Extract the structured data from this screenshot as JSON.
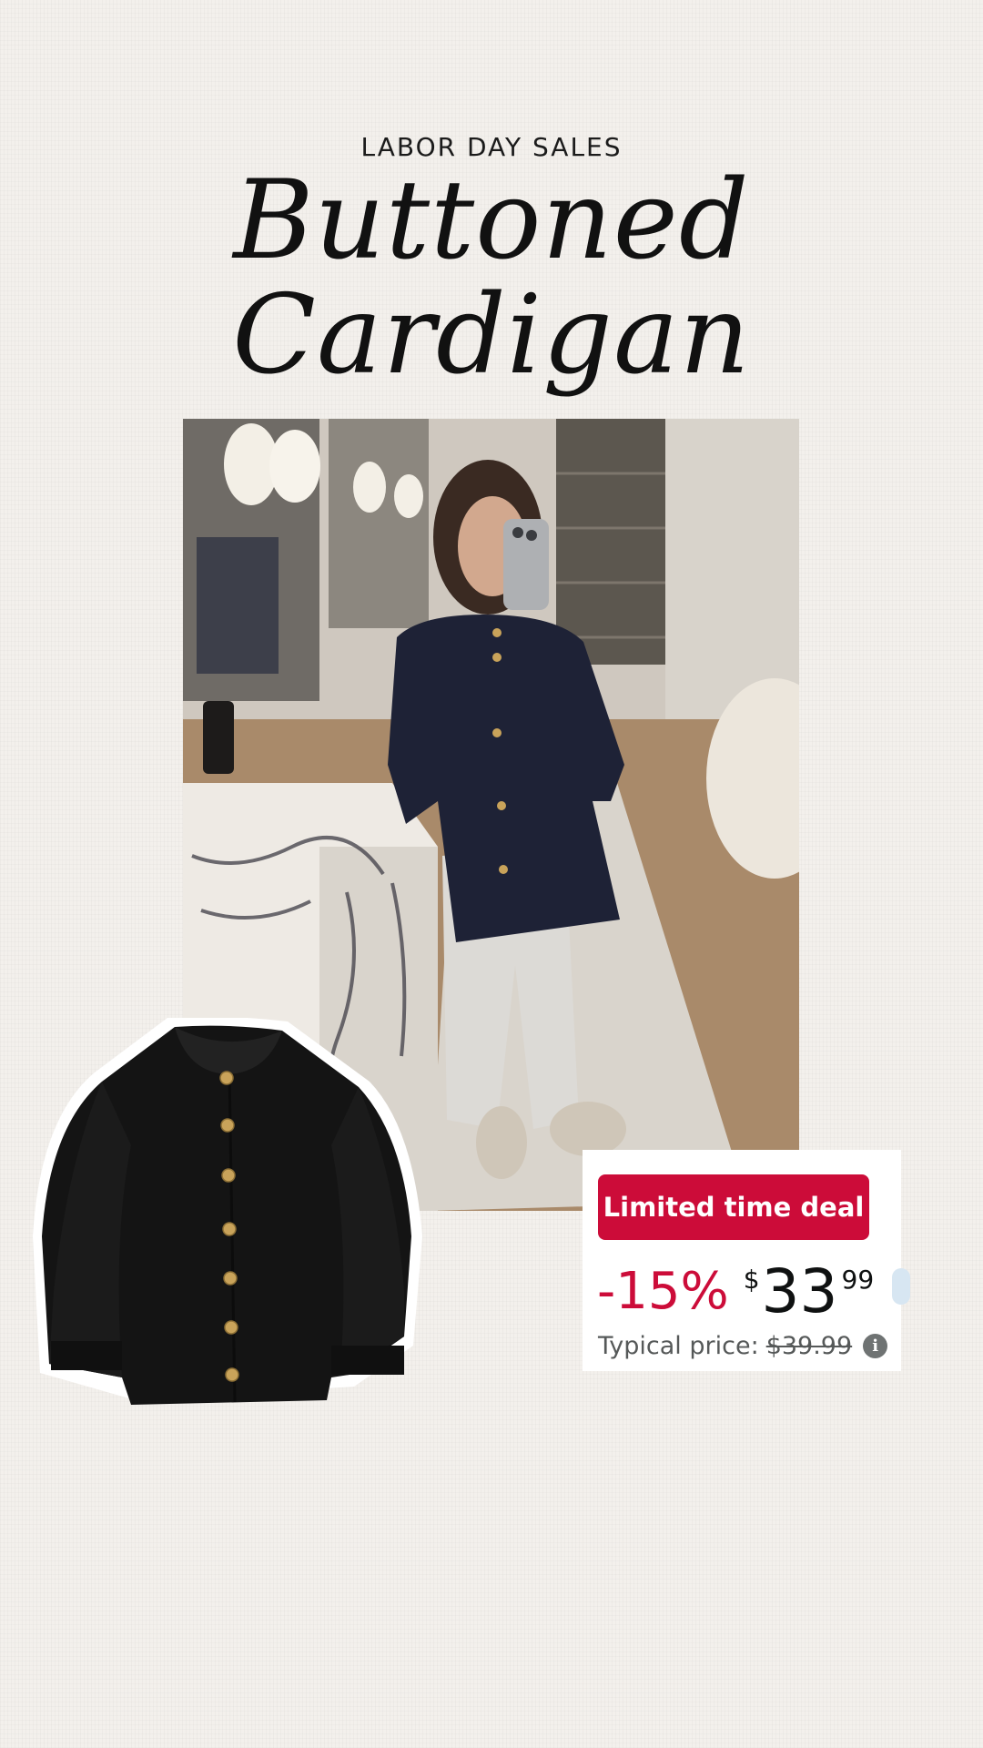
{
  "header": {
    "eyebrow": "LABOR DAY SALES",
    "title": "Buttoned Cardigan"
  },
  "deal": {
    "badge": "Limited time deal",
    "discount": "-15%",
    "currency_symbol": "$",
    "price_whole": "33",
    "price_fraction": "99",
    "typical_label": "Typical price:",
    "typical_price": "$39.99",
    "info_icon": "info-icon"
  },
  "colors": {
    "background": "#f3f0ec",
    "deal_red": "#cc0c39",
    "price_text": "#0f1111",
    "muted_text": "#565959",
    "cardigan": "#141414",
    "button_gold": "#c9a35a"
  }
}
